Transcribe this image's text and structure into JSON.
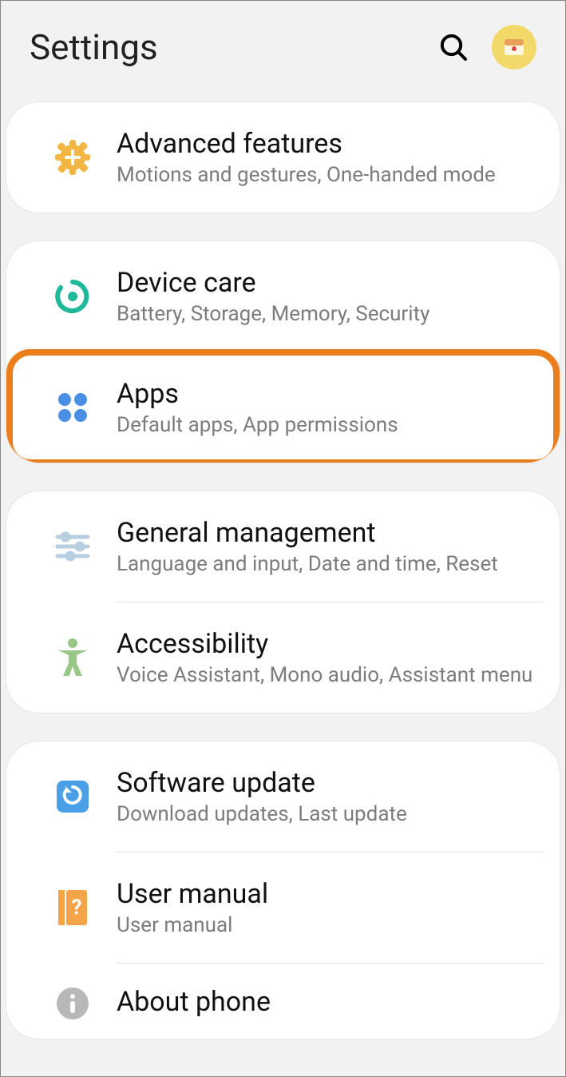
{
  "header": {
    "title": "Settings"
  },
  "groups": [
    {
      "items": [
        {
          "title": "Advanced features",
          "sub": "Motions and gestures, One-handed mode"
        }
      ]
    },
    {
      "items": [
        {
          "title": "Device care",
          "sub": "Battery, Storage, Memory, Security"
        },
        {
          "title": "Apps",
          "sub": "Default apps, App permissions"
        }
      ]
    },
    {
      "items": [
        {
          "title": "General management",
          "sub": "Language and input, Date and time, Reset"
        },
        {
          "title": "Accessibility",
          "sub": "Voice Assistant, Mono audio, Assistant menu"
        }
      ]
    },
    {
      "items": [
        {
          "title": "Software update",
          "sub": "Download updates, Last update"
        },
        {
          "title": "User manual",
          "sub": "User manual"
        },
        {
          "title": "About phone",
          "sub": ""
        }
      ]
    }
  ]
}
